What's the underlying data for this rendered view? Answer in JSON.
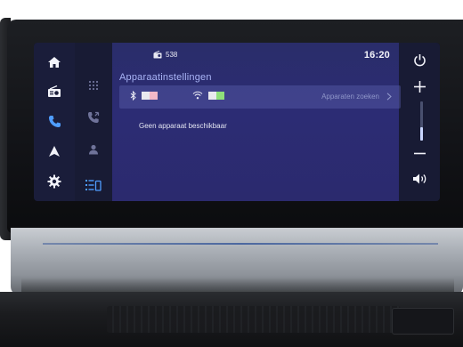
{
  "status_bar": {
    "radio_label": "538",
    "time": "16:20"
  },
  "page": {
    "title": "Apparaatinstellingen",
    "search_devices_label": "Apparaten zoeken",
    "no_device_message": "Geen apparaat beschikbaar"
  },
  "toggles": {
    "bluetooth_on": false,
    "wifi_on": true,
    "on_color": "#8fe07a",
    "off_color": "#e9e9ee"
  },
  "left_rail": {
    "items": [
      "home-icon",
      "radio-icon",
      "phone-icon",
      "navigation-icon",
      "settings-icon"
    ],
    "active": "phone-icon",
    "active_color": "#4f9dff"
  },
  "sub_rail": {
    "items": [
      "keypad-icon",
      "call-log-icon",
      "contacts-icon",
      "device-list-icon"
    ],
    "active": "device-list-icon"
  },
  "right_rail": {
    "items": [
      "power-icon",
      "volume-up-icon",
      "volume-down-icon",
      "speaker-icon"
    ],
    "volume_level": 0.35
  },
  "colors": {
    "panel": "#2c2c74",
    "title_accent": "#a9b4f6",
    "icon_white": "#f2f3fa",
    "icon_dim": "#6f739a"
  }
}
